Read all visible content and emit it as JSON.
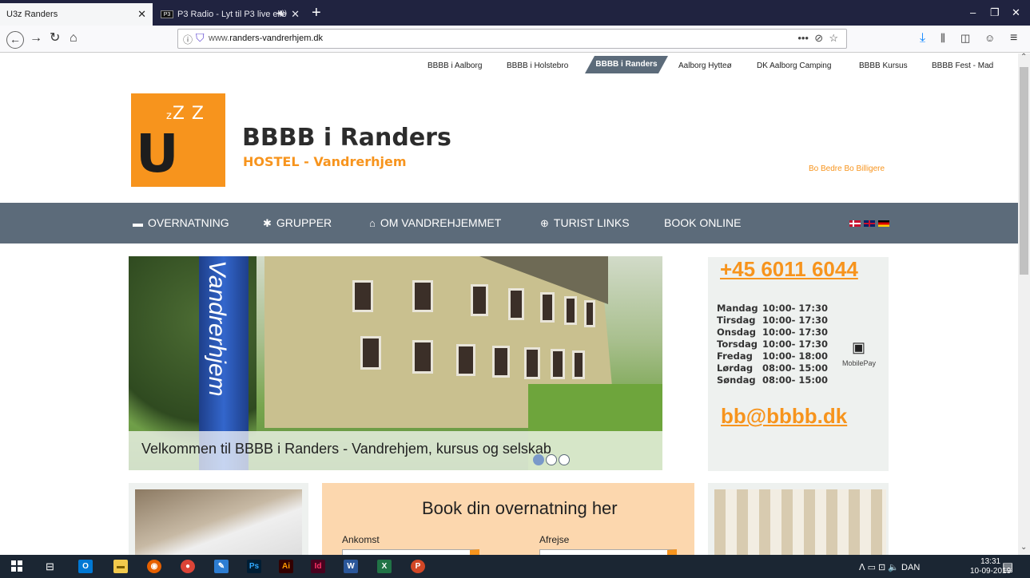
{
  "browser": {
    "tabs": [
      {
        "label": "U3z Randers",
        "close": "✕"
      },
      {
        "label": "P3 Radio - Lyt til P3 live elle",
        "favicon_text": "P3",
        "sound": "◀))",
        "close": "✕"
      }
    ],
    "new_tab": "+",
    "window_controls": {
      "minimize": "–",
      "restore": "❐",
      "close": "✕"
    },
    "nav": {
      "back": "←",
      "forward": "→",
      "reload": "↻",
      "home": "⌂"
    },
    "url": {
      "prefix": "www.",
      "domain": "randers-vandrerhjem.dk",
      "more": "•••",
      "pocket": "⊘",
      "bookmark": "☆"
    },
    "toolbar_right": {
      "download": "⤓",
      "library": "⫼",
      "sidebar": "◫",
      "account": "☺",
      "menu": "≡"
    }
  },
  "site_nav": {
    "items": [
      "BBBB i Aalborg",
      "BBBB i Holstebro",
      "BBBB i Randers",
      "Aalborg Hytteø",
      "DK Aalborg Camping",
      "BBBB Kursus",
      "BBBB Fest - Mad"
    ],
    "active": "BBBB i Randers"
  },
  "brand": {
    "logo_z_small": "z",
    "logo_z_big": "Z Z",
    "logo_letter": "U",
    "title": "BBBB i Randers",
    "subtitle": "HOSTEL - Vandrerhjem",
    "slogan": "Bo Bedre Bo Billigere"
  },
  "menu": {
    "items": [
      {
        "icon": "▬",
        "label": "OVERNATNING"
      },
      {
        "icon": "✱",
        "label": "GRUPPER"
      },
      {
        "icon": "⌂",
        "label": "OM VANDREHJEMMET"
      },
      {
        "icon": "⊕",
        "label": "TURIST LINKS"
      },
      {
        "icon": "",
        "label": "BOOK ONLINE"
      }
    ]
  },
  "hero": {
    "pillar_text": "Vandrerhjem",
    "caption": "Velkommen til BBBB i Randers - Vandrehjem, kursus og selskab",
    "slides": 3,
    "active_slide": 1
  },
  "contact": {
    "phone": "+45 6011 6044",
    "hours": [
      {
        "day": "Mandag",
        "time": "10:00- 17:30"
      },
      {
        "day": "Tirsdag",
        "time": "10:00- 17:30"
      },
      {
        "day": "Onsdag",
        "time": "10:00- 17:30"
      },
      {
        "day": "Torsdag",
        "time": "10:00- 17:30"
      },
      {
        "day": "Fredag",
        "time": "10:00- 18:00"
      },
      {
        "day": "Lørdag",
        "time": "08:00- 15:00"
      },
      {
        "day": "Søndag",
        "time": "08:00- 15:00"
      }
    ],
    "mobilepay": "MobilePay",
    "email": "bb@bbbb.dk"
  },
  "booking": {
    "title": "Book din overnatning her",
    "arrival_label": "Ankomst",
    "departure_label": "Afrejse"
  },
  "taskbar": {
    "apps": [
      {
        "label": "Ps",
        "bg": "#001d34",
        "fg": "#31a8ff"
      },
      {
        "label": "Ai",
        "bg": "#330000",
        "fg": "#ff9a00"
      },
      {
        "label": "Id",
        "bg": "#49021f",
        "fg": "#ff3366"
      },
      {
        "label": "W",
        "bg": "#2b579a",
        "fg": "#ffffff"
      },
      {
        "label": "X",
        "bg": "#217346",
        "fg": "#ffffff"
      },
      {
        "label": "P",
        "bg": "#d24726",
        "fg": "#ffffff"
      }
    ],
    "tray": "ᐱ ▭ ⊡ 🔈 DAN",
    "time": "13:31",
    "date": "10-09-2019"
  }
}
